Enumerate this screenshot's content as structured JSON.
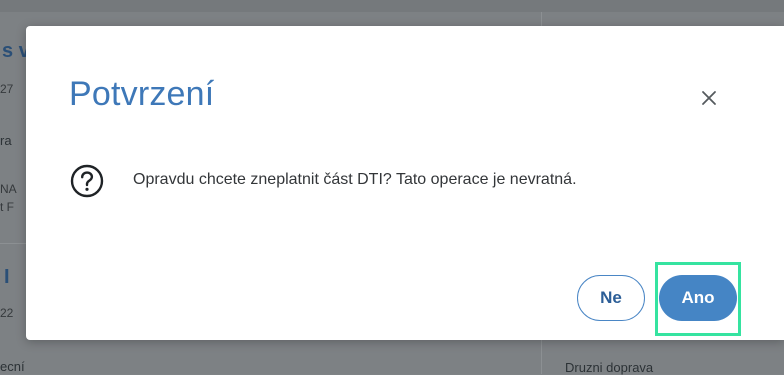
{
  "background": {
    "fragments": [
      "s v",
      "27",
      "ra",
      "NA",
      "t F",
      "I",
      "22",
      "ecní",
      "Druzni doprava",
      "<"
    ]
  },
  "dialog": {
    "title": "Potvrzení",
    "close_icon": "close-icon",
    "status_icon": "question-circle-icon",
    "message": "Opravdu chcete zneplatnit část DTI? Tato operace je nevratná.",
    "buttons": {
      "no_label": "Ne",
      "yes_label": "Ano"
    }
  },
  "colors": {
    "accent": "#4585c5",
    "title": "#3e78b8",
    "focus_highlight": "#35e3a0"
  }
}
